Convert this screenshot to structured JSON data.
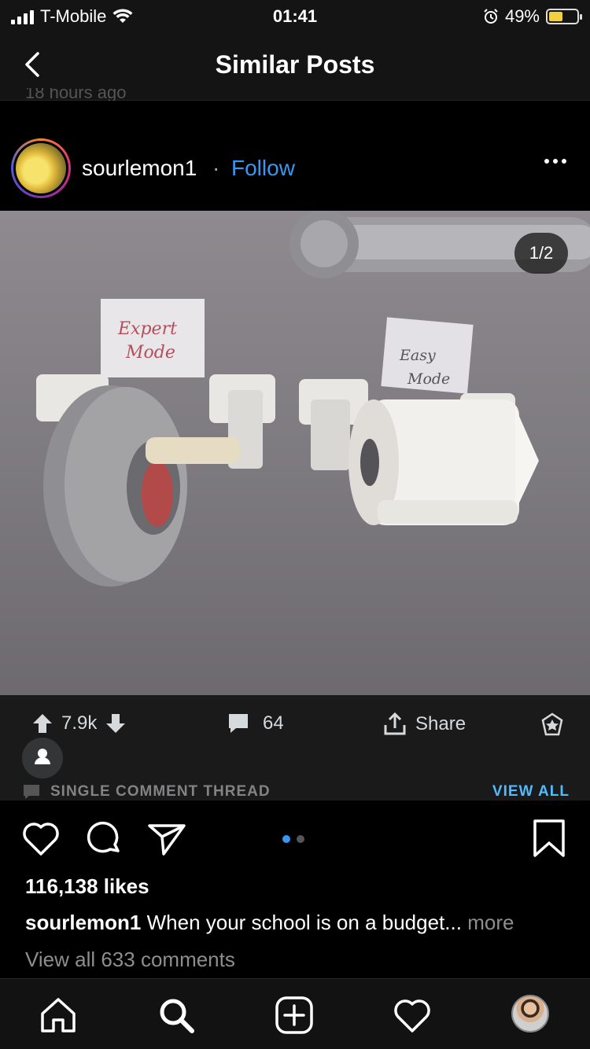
{
  "status_bar": {
    "carrier": "T-Mobile",
    "time": "01:41",
    "battery": "49%",
    "battery_level": 0.49
  },
  "nav": {
    "title": "Similar Posts",
    "faded_text": "18 hours ago"
  },
  "post": {
    "username": "sourlemon1",
    "separator": "·",
    "follow_label": "Follow",
    "image_counter": "1/2",
    "image_labels": {
      "left_note": "Expert Mode",
      "right_note": "Easy Mode"
    }
  },
  "reddit_bar": {
    "upvotes": "7.9k",
    "comments": "64",
    "share_label": "Share",
    "thread_label": "SINGLE COMMENT THREAD",
    "view_all_label": "VIEW ALL"
  },
  "instagram": {
    "likes": "116,138 likes",
    "caption_user": "sourlemon1",
    "caption_text": "When your school is on a budget...",
    "caption_more": "more",
    "view_comments": "View all 633 comments",
    "carousel_count": 2,
    "carousel_active": 0
  },
  "tabbar": {
    "tabs": [
      "home",
      "search",
      "create",
      "activity",
      "profile"
    ]
  },
  "colors": {
    "follow_blue": "#3897f0",
    "reddit_blue": "#4fbcff",
    "battery_yellow": "#f4d03f"
  }
}
